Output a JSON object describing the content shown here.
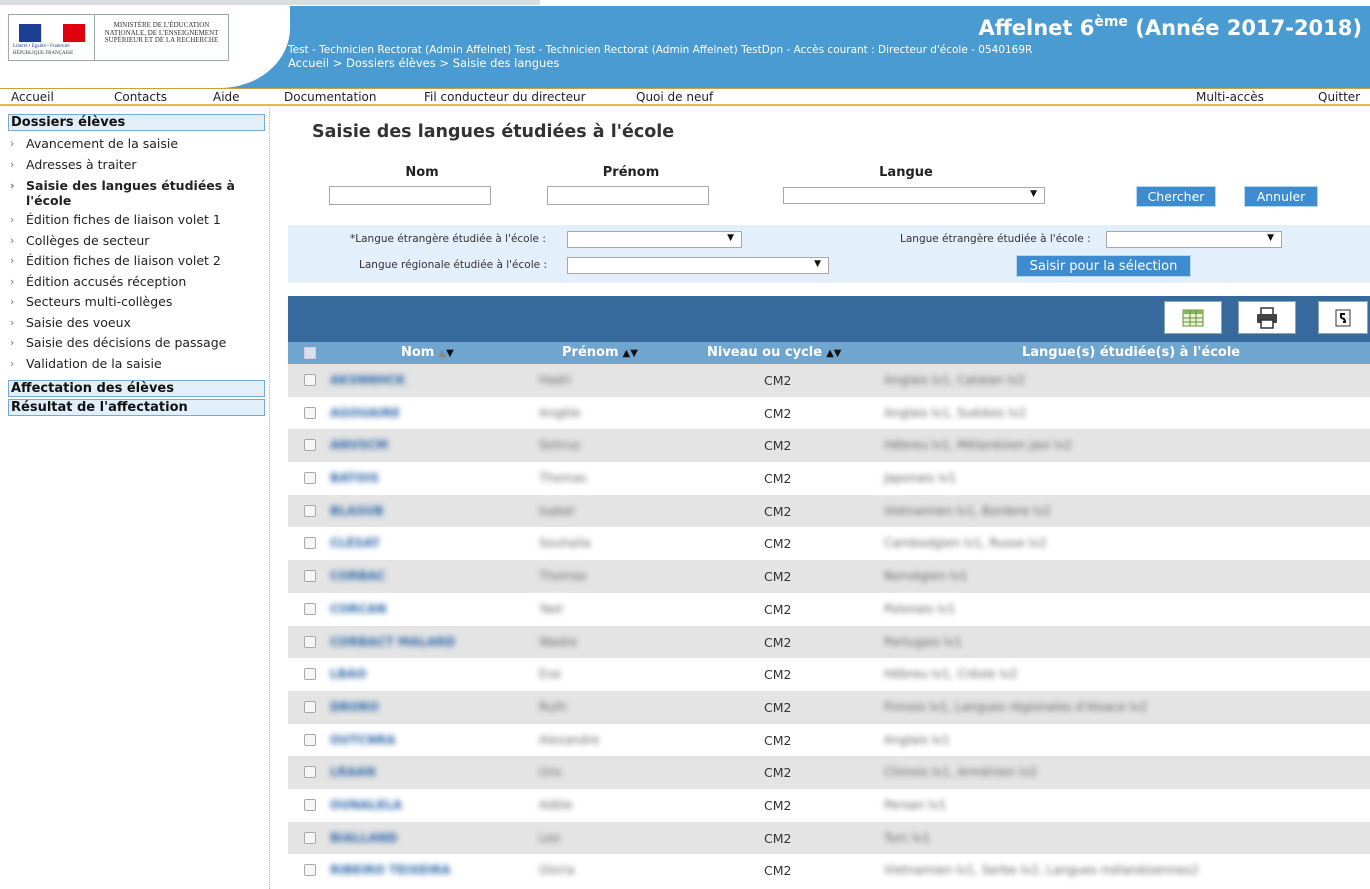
{
  "header": {
    "ministry_text": "MINISTÈRE DE L'ÉDUCATION NATIONALE, DE L'ENSEIGNEMENT SUPÉRIEUR ET DE LA RECHERCHE",
    "devise": "Liberté • Égalité • Fraternité",
    "rf": "RÉPUBLIQUE FRANÇAISE",
    "app_title_main": "Affelnet 6",
    "app_title_sup": "ème",
    "app_title_year": " (Année 2017-2018)",
    "user_line": "Test - Technicien Rectorat (Admin Affelnet) Test - Technicien Rectorat (Admin Affelnet) TestDpn - Accès courant : Directeur d'école - 0540169R",
    "breadcrumb": "Accueil > Dossiers élèves > Saisie des langues"
  },
  "menubar": {
    "accueil": "Accueil",
    "contacts": "Contacts",
    "aide": "Aide",
    "documentation": "Documentation",
    "fil": "Fil conducteur du directeur",
    "quoi": "Quoi de neuf",
    "multi": "Multi-accès",
    "quitter": "Quitter"
  },
  "sidebar": {
    "section1": "Dossiers élèves",
    "items": [
      "Avancement de la saisie",
      "Adresses à traiter",
      "Saisie des langues étudiées à l'école",
      "Édition fiches de liaison volet 1",
      "Collèges de secteur",
      "Édition fiches de liaison volet 2",
      "Édition accusés réception",
      "Secteurs multi-collèges",
      "Saisie des voeux",
      "Saisie des décisions de passage",
      "Validation de la saisie"
    ],
    "section2": "Affectation des élèves",
    "section3": "Résultat de l'affectation"
  },
  "main": {
    "title": "Saisie des langues étudiées à l'école",
    "search": {
      "nom_label": "Nom",
      "prenom_label": "Prénom",
      "langue_label": "Langue",
      "chercher": "Chercher",
      "annuler": "Annuler"
    },
    "selection": {
      "langue_etrangere_required": "*Langue étrangère étudiée à l'école :",
      "langue_etrangere": "Langue étrangère étudiée à l'école :",
      "langue_regionale": "Langue régionale étudiée à l'école :",
      "saisir": "Saisir pour la sélection"
    },
    "table": {
      "toolbar_icons": [
        "spreadsheet-export-icon",
        "print-icon",
        "return-icon"
      ],
      "columns": {
        "nom": "Nom",
        "prenom": "Prénom",
        "niveau": "Niveau ou cycle",
        "langues": "Langue(s) étudiée(s) à l'école"
      },
      "sort_up": "▲",
      "sort_down": "▼",
      "rows": [
        {
          "nom": "AKSNNHCK",
          "prenom": "Hadri",
          "niveau": "CM2",
          "langue": "Anglais lv1, Catalan lv2"
        },
        {
          "nom": "AGOUAIRE",
          "prenom": "Angèle",
          "niveau": "CM2",
          "langue": "Anglais lv1, Suédois lv2"
        },
        {
          "nom": "ANVSCM",
          "prenom": "Sohrus",
          "niveau": "CM2",
          "langue": "Hébreu lv1, Mélanésien jaoi lv2"
        },
        {
          "nom": "BATOIS",
          "prenom": "Thomas",
          "niveau": "CM2",
          "langue": "Japonais lv1"
        },
        {
          "nom": "BLASUB",
          "prenom": "Isabel",
          "niveau": "CM2",
          "langue": "Vietnamien lv1, Bordere lv2"
        },
        {
          "nom": "CLÉSAT",
          "prenom": "Souhaila",
          "niveau": "CM2",
          "langue": "Cambodgien lv1, Russe lv2"
        },
        {
          "nom": "CORBAC",
          "prenom": "Thomas",
          "niveau": "CM2",
          "langue": "Norvégien lv1"
        },
        {
          "nom": "CORCAN",
          "prenom": "Yael",
          "niveau": "CM2",
          "langue": "Polonais lv1"
        },
        {
          "nom": "CORBACT MALARD",
          "prenom": "Wadre",
          "niveau": "CM2",
          "langue": "Portugais lv1"
        },
        {
          "nom": "LBAO",
          "prenom": "Eve",
          "niveau": "CM2",
          "langue": "Hébreu lv1, Créole lv2"
        },
        {
          "nom": "DRORO",
          "prenom": "Ruth",
          "niveau": "CM2",
          "langue": "Finnois lv1, Langues régionales d'Alsace lv2"
        },
        {
          "nom": "OUTCNRA",
          "prenom": "Alexandre",
          "niveau": "CM2",
          "langue": "Anglais lv1"
        },
        {
          "nom": "LRAAN",
          "prenom": "Uns",
          "niveau": "CM2",
          "langue": "Chinois lv1, Arménien lv2"
        },
        {
          "nom": "OUNALELA",
          "prenom": "Adèle",
          "niveau": "CM2",
          "langue": "Persan lv1"
        },
        {
          "nom": "BIALLAND",
          "prenom": "Leo",
          "niveau": "CM2",
          "langue": "Turc lv1"
        },
        {
          "nom": "RIBEIRO TEIXEIRA",
          "prenom": "Gloria",
          "niveau": "CM2",
          "langue": "Vietnamien lv1, Serbe lv2, Langues mélanésiennes2"
        }
      ]
    }
  }
}
